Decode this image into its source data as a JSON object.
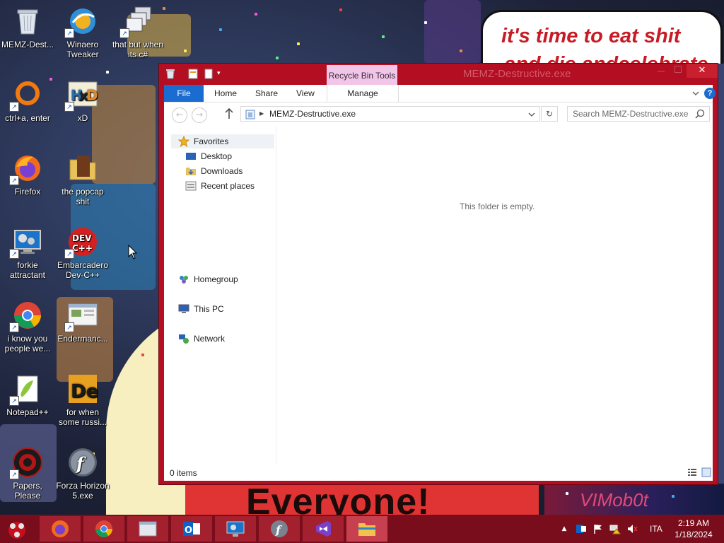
{
  "wallpaper": {
    "bubble_line1": "it's time to eat shit",
    "bubble_line2": "and die andcelebrate",
    "sign_text": "Everyone!",
    "corner_text": "VIMob0t"
  },
  "desktop_icons": [
    {
      "label": "MEMZ-Dest...",
      "icon": "recycle-bin-icon"
    },
    {
      "label": "Winaero Tweaker",
      "icon": "winaero-icon"
    },
    {
      "label": "that but when its c#",
      "icon": "stacked-windows-icon"
    },
    {
      "label": "ctrl+a, enter",
      "icon": "ring-icon"
    },
    {
      "label": "xD",
      "icon": "hxd-icon"
    },
    {
      "label": "Firefox",
      "icon": "firefox-icon"
    },
    {
      "label": "the popcap shit",
      "icon": "popcap-folder-icon"
    },
    {
      "label": "forkie attractant",
      "icon": "monitor-gear-icon"
    },
    {
      "label": "Embarcadero Dev-C++",
      "icon": "devcpp-icon"
    },
    {
      "label": "i know you people we...",
      "icon": "chrome-icon"
    },
    {
      "label": "Endermanc...",
      "icon": "endermanch-icon"
    },
    {
      "label": "Notepad++",
      "icon": "notepadpp-icon"
    },
    {
      "label": "for when some russi...",
      "icon": "de-icon"
    },
    {
      "label": "Papers, Please",
      "icon": "papers-please-icon"
    },
    {
      "label": "Forza Horizon 5.exe",
      "icon": "flash-icon"
    }
  ],
  "window": {
    "title": "MEMZ-Destructive.exe",
    "context_tab": "Recycle Bin Tools",
    "close_symbol": "✕",
    "ribbon_tabs": [
      "File",
      "Home",
      "Share",
      "View",
      "Manage"
    ],
    "address": "MEMZ-Destructive.exe",
    "search_placeholder": "Search MEMZ-Destructive.exe",
    "empty_message": "This folder is empty.",
    "status": "0 items",
    "help_symbol": "?"
  },
  "nav_pane": {
    "favorites": "Favorites",
    "desktop": "Desktop",
    "downloads": "Downloads",
    "recent": "Recent places",
    "homegroup": "Homegroup",
    "this_pc": "This PC",
    "network": "Network"
  },
  "taskbar": {
    "apps": [
      "firefox-icon",
      "chrome-icon",
      "window-manager-icon",
      "outlook-icon",
      "monitor-gear-icon",
      "flash-icon",
      "visual-studio-icon",
      "file-explorer-icon"
    ],
    "language": "ITA",
    "time": "2:19 AM",
    "date": "1/18/2024"
  },
  "colors": {
    "window_frame": "#b30e22",
    "taskbar": "#7a0d1b",
    "ribbon_file": "#1a6cd0",
    "context_tab": "#f2c6e8"
  }
}
